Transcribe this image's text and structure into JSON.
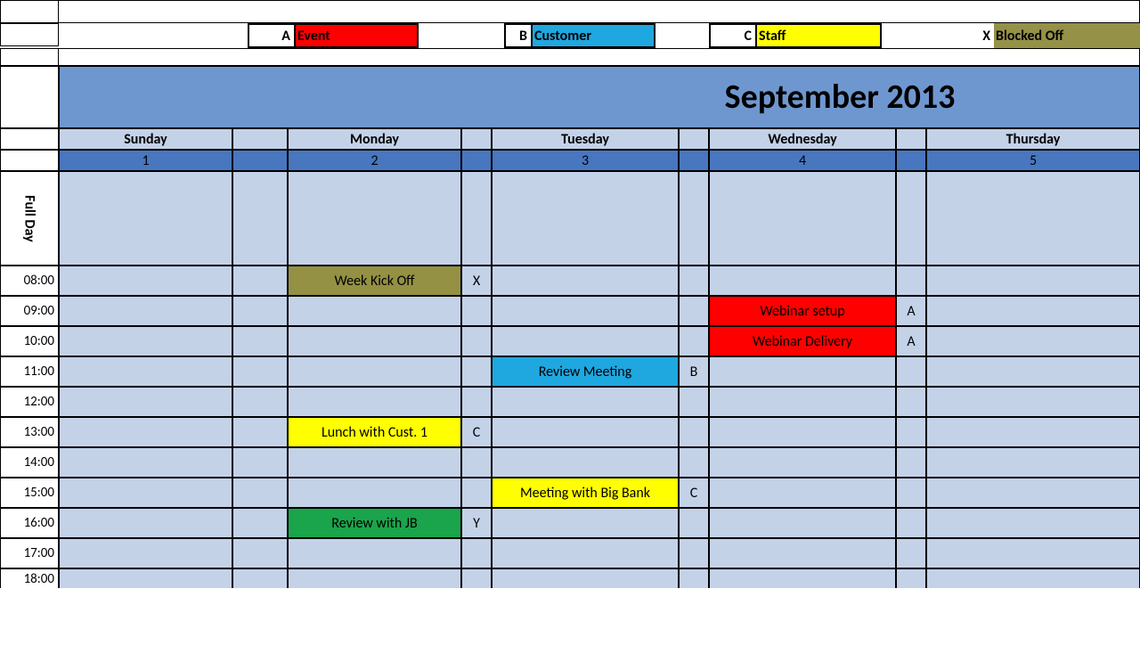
{
  "legend": {
    "a_key": "A",
    "a_label": "Event",
    "b_key": "B",
    "b_label": "Customer",
    "c_key": "C",
    "c_label": "Staff",
    "x_key": "X",
    "x_label": "Blocked Off"
  },
  "title": "September 2013",
  "days": {
    "sun": {
      "name": "Sunday",
      "num": "1"
    },
    "mon": {
      "name": "Monday",
      "num": "2"
    },
    "tue": {
      "name": "Tuesday",
      "num": "3"
    },
    "wed": {
      "name": "Wednesday",
      "num": "4"
    },
    "thu": {
      "name": "Thursday",
      "num": "5"
    }
  },
  "rowlabels": {
    "fullday": "Full Day",
    "t08": "08:00",
    "t09": "09:00",
    "t10": "10:00",
    "t11": "11:00",
    "t12": "12:00",
    "t13": "13:00",
    "t14": "14:00",
    "t15": "15:00",
    "t16": "16:00",
    "t17": "17:00",
    "t18": "18:00"
  },
  "events": {
    "mon_08": {
      "text": "Week Kick Off",
      "code": "X"
    },
    "mon_13": {
      "text": "Lunch with Cust. 1",
      "code": "C"
    },
    "mon_16": {
      "text": "Review with JB",
      "code": "Y"
    },
    "tue_11": {
      "text": "Review Meeting",
      "code": "B"
    },
    "tue_15": {
      "text": "Meeting with Big Bank",
      "code": "C"
    },
    "wed_09": {
      "text": "Webinar setup",
      "code": "A"
    },
    "wed_10": {
      "text": "Webinar Delivery",
      "code": "A"
    }
  }
}
